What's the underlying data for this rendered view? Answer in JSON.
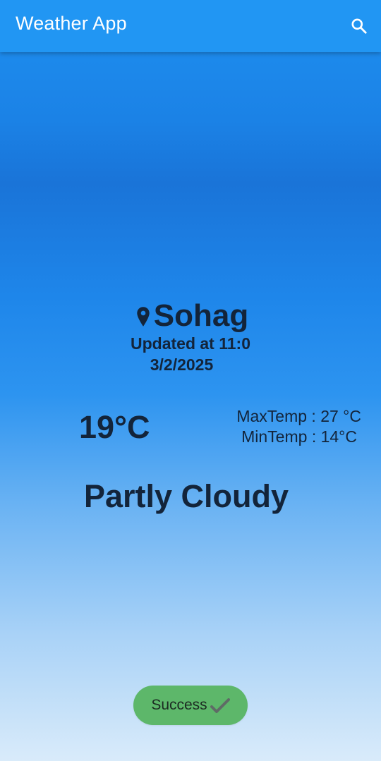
{
  "appbar": {
    "title": "Weather App",
    "search_icon": "search-icon",
    "color": "#2196F3"
  },
  "location": {
    "icon": "location-pin-icon",
    "city": "Sohag",
    "updated": "Updated at 11:0",
    "date": "3/2/2025"
  },
  "weather": {
    "temperature": "19°C",
    "max_temp": "MaxTemp : 27 °C",
    "min_temp": "MinTemp : 14°C",
    "condition": "Partly Cloudy"
  },
  "toast": {
    "label": "Success",
    "icon": "checkmark-icon",
    "color": "#5DB76A"
  },
  "colors": {
    "text": "#13243A",
    "appbar": "#2196F3",
    "gradient_top": "#1E90F0",
    "gradient_bottom": "#D9EBFA"
  }
}
